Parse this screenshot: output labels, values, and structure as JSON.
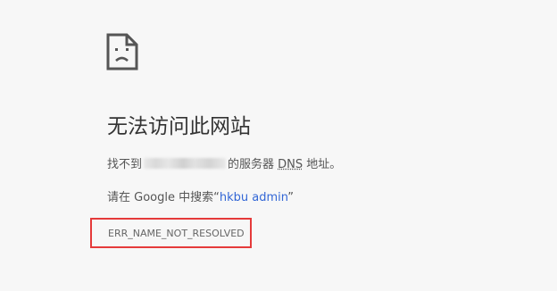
{
  "error_page": {
    "icon": "sad-page-icon",
    "heading": "无法访问此网站",
    "dns_line": {
      "prefix": "找不到",
      "redacted_host": "",
      "middle": "的服务器 ",
      "dns": "DNS",
      "suffix": " 地址。"
    },
    "search_line": {
      "prefix": "请在 Google 中搜索“",
      "query": "hkbu admin",
      "suffix": "”"
    },
    "error_code": "ERR_NAME_NOT_RESOLVED"
  },
  "annotation": {
    "highlight_color": "#e53a3a"
  },
  "colors": {
    "background": "#f7f7f7",
    "link": "#3367d6",
    "text": "#333333"
  }
}
